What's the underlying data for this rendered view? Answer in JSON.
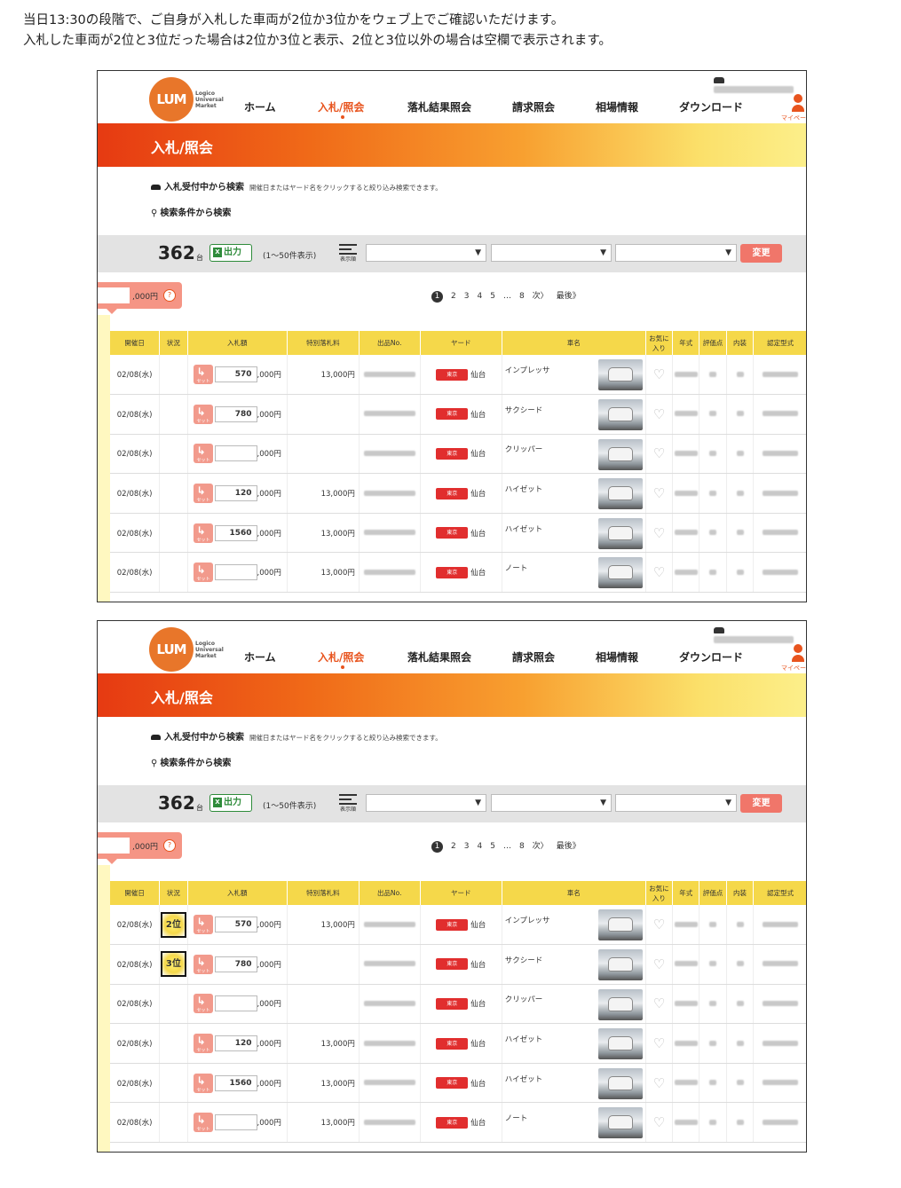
{
  "intro": {
    "line1": "当日13:30の段階で、ご自身が入札した車両が2位か3位かをウェブ上でご確認いただけます。",
    "line2": "入札した車両が2位と3位だった場合は2位か3位と表示、2位と3位以外の場合は空欄で表示されます。"
  },
  "site": {
    "logo_text": "LUM",
    "logo_name_1": "Logico",
    "logo_name_2": "Universal",
    "logo_name_3": "Market",
    "nav": [
      "ホーム",
      "入札/照会",
      "落札結果照会",
      "請求照会",
      "相場情報",
      "ダウンロード"
    ],
    "mypage_label": "マイペー",
    "banner_title": "入札/照会",
    "search_accepting": "入札受付中から検索",
    "search_accepting_hint": "開催日またはヤード名をクリックすると絞り込み検索できます。",
    "search_conditions": "検索条件から検索",
    "count": "362",
    "count_unit": "台",
    "excel_label": "出力",
    "range_label": "(1〜50件表示)",
    "sort_label": "表示順",
    "change_label": "変更",
    "bid_total_unit": ",000円",
    "help_icon": "?",
    "pager": {
      "pages": [
        "2",
        "3",
        "4",
        "5",
        "…",
        "8",
        "次〉",
        "最後》"
      ],
      "current": "1"
    },
    "table": {
      "headers": [
        "開催日",
        "状況",
        "入札額",
        "特別落札料",
        "出品No.",
        "ヤード",
        "車名",
        "お気に入り",
        "年式",
        "評価点",
        "内装",
        "認定型式"
      ],
      "bid_unit": ",000円",
      "yard_pin": "東京",
      "set_label": "セット",
      "rows": [
        {
          "date": "02/08(水)",
          "bid": "570",
          "fee": "13,000円",
          "yard": "仙台",
          "car": "インプレッサ",
          "rank": "2位"
        },
        {
          "date": "02/08(水)",
          "bid": "780",
          "fee": "",
          "yard": "仙台",
          "car": "サクシード",
          "rank": "3位"
        },
        {
          "date": "02/08(水)",
          "bid": "",
          "fee": "",
          "yard": "仙台",
          "car": "クリッパー",
          "rank": ""
        },
        {
          "date": "02/08(水)",
          "bid": "120",
          "fee": "13,000円",
          "yard": "仙台",
          "car": "ハイゼット",
          "rank": ""
        },
        {
          "date": "02/08(水)",
          "bid": "1560",
          "fee": "13,000円",
          "yard": "仙台",
          "car": "ハイゼット",
          "rank": ""
        },
        {
          "date": "02/08(水)",
          "bid": "",
          "fee": "13,000円",
          "yard": "仙台",
          "car": "ノート",
          "rank": ""
        }
      ]
    }
  },
  "icons": {
    "car": "car-icon",
    "search": "search-icon",
    "excel": "excel-icon",
    "sort": "sort-icon",
    "user": "user-icon",
    "heart": "heart-icon",
    "pin": "location-pin-icon"
  },
  "colors": {
    "accent": "#e8541e",
    "header_yellow": "#f5d84a",
    "pin_red": "#e12e2e",
    "set_button": "#f29a8c"
  }
}
